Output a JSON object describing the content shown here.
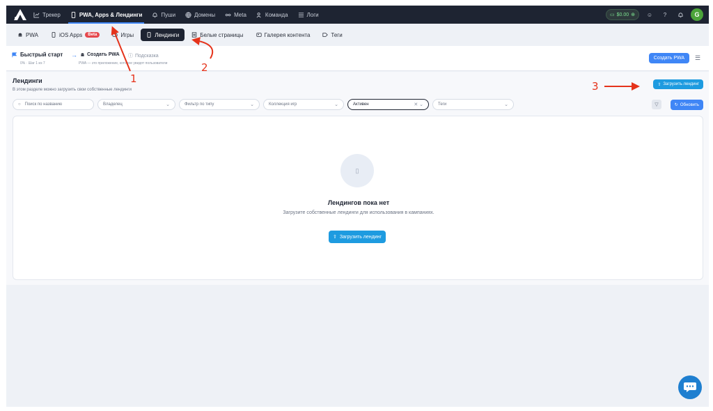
{
  "topnav": {
    "items": [
      {
        "label": "Трекер",
        "icon": "chart-icon"
      },
      {
        "label": "PWA, Apps & Лендинги",
        "icon": "phone-icon",
        "active": true
      },
      {
        "label": "Пуши",
        "icon": "bell-icon"
      },
      {
        "label": "Домены",
        "icon": "globe-icon"
      },
      {
        "label": "Meta",
        "icon": "infinity-icon"
      },
      {
        "label": "Команда",
        "icon": "team-icon"
      },
      {
        "label": "Логи",
        "icon": "list-icon"
      }
    ],
    "balance": "$0.00",
    "avatar_letter": "G"
  },
  "subnav": {
    "items": [
      {
        "label": "PWA",
        "icon": "android-icon"
      },
      {
        "label": "iOS Apps",
        "icon": "phone-icon",
        "badge": "Beta"
      },
      {
        "label": "Игры",
        "icon": "gamepad-icon"
      },
      {
        "label": "Лендинги",
        "icon": "phone-icon",
        "active": true
      },
      {
        "label": "Белые страницы",
        "icon": "page-icon"
      },
      {
        "label": "Галерея контента",
        "icon": "gallery-icon"
      },
      {
        "label": "Теги",
        "icon": "tag-icon"
      }
    ]
  },
  "quickstart": {
    "title": "Быстрый старт",
    "progress": "0% · Шаг 1 из 7",
    "step": "Создать PWA",
    "hint": "Подсказка",
    "desc": "PWA — это приложение, которое увидят пользователи",
    "create_button": "Создать PWA"
  },
  "page": {
    "title": "Лендинги",
    "desc": "В этом разделе можно загрузить свои собственные лендинги",
    "upload_button": "Загрузить лендинг",
    "refresh_button": "Обновить"
  },
  "filters": {
    "search_placeholder": "Поиск по названию",
    "owner": "Владелец",
    "type": "Фильтр по типу",
    "collection": "Коллекция игр",
    "status": "Активен",
    "tags": "Теги"
  },
  "empty": {
    "title": "Лендингов пока нет",
    "desc": "Загрузите собственные лендинги для использования в кампаниях.",
    "button": "Загрузить лендинг"
  },
  "annotations": [
    "1",
    "2",
    "3"
  ],
  "colors": {
    "accent": "#3f86f6",
    "nav_bg": "#1e2432",
    "upload": "#1e9be0",
    "annotation": "#e5331b"
  }
}
